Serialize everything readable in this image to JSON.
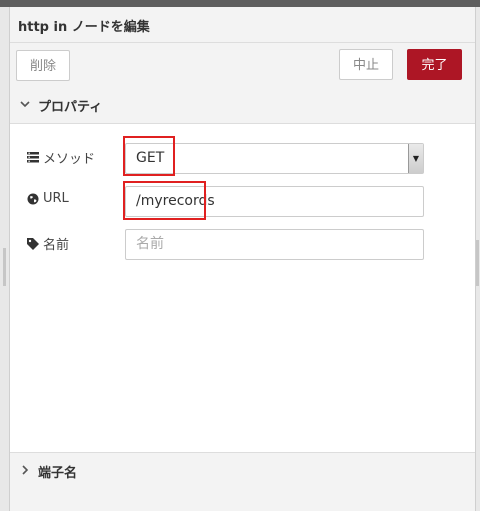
{
  "tray": {
    "title": "http in ノードを編集"
  },
  "toolbar": {
    "delete_label": "削除",
    "cancel_label": "中止",
    "done_label": "完了"
  },
  "sections": {
    "properties_label": "プロパティ",
    "ports_label": "端子名"
  },
  "form": {
    "method": {
      "label": "メソッド",
      "icon": "list-icon",
      "selected": "GET"
    },
    "url": {
      "label": "URL",
      "icon": "globe-icon",
      "value": "/myrecords"
    },
    "name": {
      "label": "名前",
      "icon": "tag-icon",
      "placeholder": "名前",
      "value": ""
    }
  },
  "colors": {
    "done_button": "#ad1625",
    "highlight": "#e02020"
  }
}
